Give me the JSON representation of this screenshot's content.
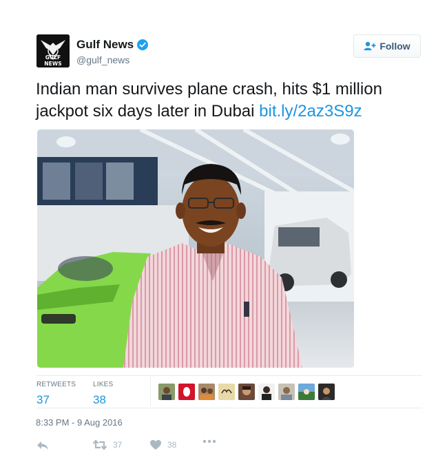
{
  "account": {
    "display_name": "Gulf News",
    "handle": "@gulf_news",
    "logo_text": "GULF NEWS",
    "verified": true
  },
  "follow_button": {
    "label": "Follow"
  },
  "tweet": {
    "text": "Indian man survives plane crash, hits $1 million jackpot six days later in Dubai ",
    "link": "bit.ly/2az3S9z"
  },
  "stats": {
    "retweets_label": "RETWEETS",
    "retweets_count": "37",
    "likes_label": "LIKES",
    "likes_count": "38"
  },
  "timestamp": "8:33 PM - 9 Aug 2016",
  "actions": {
    "reply_icon": "reply-icon",
    "retweet_icon": "retweet-icon",
    "retweet_count": "37",
    "like_icon": "heart-icon",
    "like_count": "38",
    "more_icon": "more-icon"
  },
  "colors": {
    "link": "#1b95e0",
    "muted": "#657786",
    "action": "#aab8c2",
    "text": "#14171a"
  }
}
